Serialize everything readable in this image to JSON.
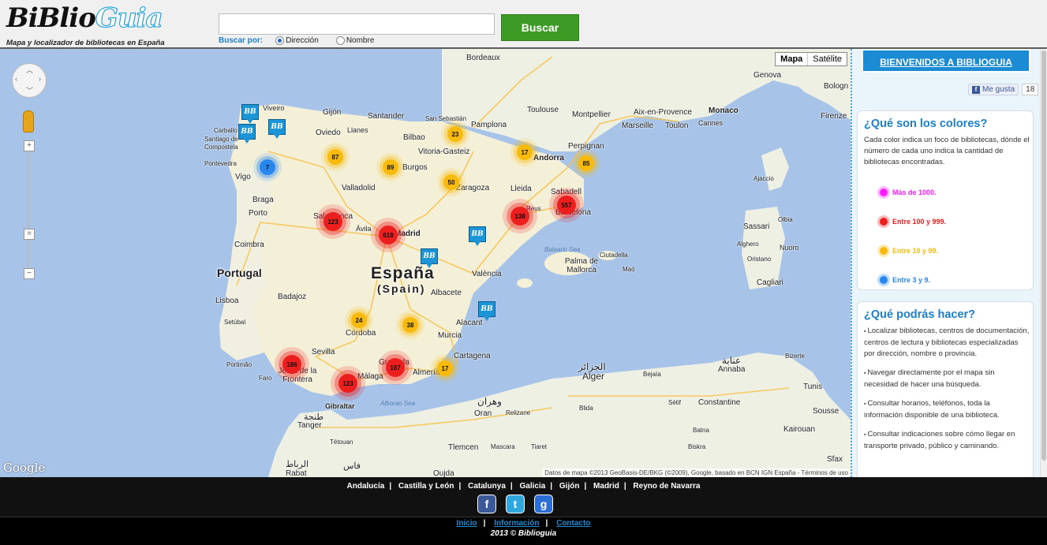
{
  "header": {
    "logo_main": "BiBlio",
    "logo_accent": "Guia",
    "tagline": "Mapa y localizador de bibliotecas en España",
    "search_button": "Buscar",
    "search_by_label": "Buscar por:",
    "option_address": "Dirección",
    "option_name": "Nombre"
  },
  "map": {
    "type_map": "Mapa",
    "type_satellite": "Satélite",
    "google": "Google",
    "attribution": "Datos de mapa ©2013 GeoBasis-DE/BKG (©2009), Google, basado en BCN IGN España - Términos de uso",
    "country_spain": "España",
    "country_spain_sub": "(Spain)",
    "country_portugal": "Portugal",
    "cities": {
      "bordeaux": "Bordeaux",
      "genova": "Genova",
      "bologna": "Bologn",
      "toulouse": "Toulouse",
      "montpellier": "Montpellier",
      "aix": "Aix-en-Provence",
      "monaco": "Monaco",
      "marseille": "Marseille",
      "toulon": "Toulon",
      "cannes": "Cannes",
      "firenze": "Firenze",
      "viveiro": "Viveiro",
      "gijon": "Gijón",
      "santander": "Santander",
      "san_sebastian": "San Sebastián",
      "carballo": "Carballo",
      "santiago": "Santiago de Compostela",
      "oviedo": "Oviedo",
      "llanes": "Llanes",
      "bilbao": "Bilbao",
      "pamplona": "Pamplona",
      "vitoria": "Vitoria-Gasteiz",
      "perpignan": "Perpignan",
      "andorra": "Andorra",
      "pontevedra": "Pontevedra",
      "vigo": "Vigo",
      "burgos": "Burgos",
      "valladolid": "Valladolid",
      "zaragoza": "Zaragoza",
      "lleida": "Lleida",
      "sabadell": "Sabadell",
      "reus": "Reus",
      "barcelona": "Barcelona",
      "ajaccio": "Ajaccio",
      "braga": "Braga",
      "porto": "Porto",
      "salamanca": "Salamanca",
      "avila": "Ávila",
      "madrid": "Madrid",
      "sassari": "Sassari",
      "olbia": "Olbia",
      "alghero": "Alghero",
      "nuoro": "Nuoro",
      "oristano": "Oristano",
      "balearic": "Balearic Sea",
      "palma": "Palma de Mallorca",
      "ciutadella": "Ciutadella",
      "mao": "Maó",
      "coimbra": "Coimbra",
      "valencia": "València",
      "albacete": "Albacete",
      "cagliari": "Cagliari",
      "lisboa": "Lisboa",
      "badajoz": "Badajoz",
      "setubal": "Setúbal",
      "alacant": "Alacant",
      "cordoba": "Córdoba",
      "murcia": "Murcia",
      "sevilla": "Sevilla",
      "cartagena": "Cartagena",
      "portimao": "Portimão",
      "faro": "Faro",
      "jerez": "Jerez de la Frontera",
      "malaga": "Málaga",
      "granada": "Granada",
      "almeria": "Almería",
      "alger_ar": "الجزائر",
      "alger": "Alger",
      "bejaia": "Bejaïa",
      "annaba_ar": "عنابة",
      "annaba": "Annaba",
      "bizerte": "Bizerte",
      "tunis": "Tunis",
      "gibraltar": "Gibraltar",
      "alboran": "Alboran Sea",
      "oran_ar": "وهران",
      "oran": "Oran",
      "relizane": "Relizane",
      "blida": "Blida",
      "setif": "Sétif",
      "constantine": "Constantine",
      "sousse": "Sousse",
      "tanger_ar": "طنجة",
      "tanger": "Tanger",
      "tetouan": "Tétouan",
      "tlemcen": "Tlemcen",
      "mascara": "Mascara",
      "tiaret": "Tiaret",
      "batna": "Batna",
      "biskra": "Biskra",
      "kairouan": "Kairouan",
      "rabat_ar": "الرباط",
      "rabat": "Rabat",
      "fes_ar": "فاس",
      "oujda": "Oujda",
      "sfax": "Sfax"
    },
    "clusters": [
      "87",
      "23",
      "17",
      "89",
      "7",
      "50",
      "85",
      "123",
      "618",
      "138",
      "557",
      "24",
      "38",
      "186",
      "123",
      "187",
      "17"
    ],
    "marker_label": "BB"
  },
  "sidebar": {
    "welcome": "BIENVENIDOS A BIBLIOGUIA",
    "like": "Me gusta",
    "like_count": "18",
    "colors_title": "¿Qué son los colores?",
    "colors_text": "Cada color indica un foco de bibliotecas, dónde el número de cada uno indica la cantidad de bibliotecas encontradas.",
    "legend": [
      {
        "label": "Más de 1000.",
        "color": "#ff1dff"
      },
      {
        "label": "Entre 100 y 999.",
        "color": "#ec1e1e"
      },
      {
        "label": "Entre 10 y 99.",
        "color": "#f8bb0d"
      },
      {
        "label": "Entre 3 y 9.",
        "color": "#2887ef"
      }
    ],
    "can_title": "¿Qué podrás hacer?",
    "can_items": [
      "Localizar bibliotecas, centros de documentación, centros de lectura y bibliotecas especializadas por dirección, nombre o provincia.",
      "Navegar directamente por el mapa sin necesidad de hacer una búsqueda.",
      "Consultar horarios, teléfonos, toda la información disponible de una biblioteca.",
      "Consultar indicaciones sobre cómo llegar en transporte privado, público y caminando."
    ]
  },
  "footer": {
    "regions": [
      "Andalucía",
      "Castilla y León",
      "Catalunya",
      "Galicia",
      "Gijón",
      "Madrid",
      "Reyno de Navarra"
    ],
    "social": {
      "facebook": "f",
      "twitter": "t",
      "google": "g"
    },
    "links": [
      "Inicio",
      "Información",
      "Contacto"
    ],
    "copyright": "2013 © Biblioguia"
  }
}
